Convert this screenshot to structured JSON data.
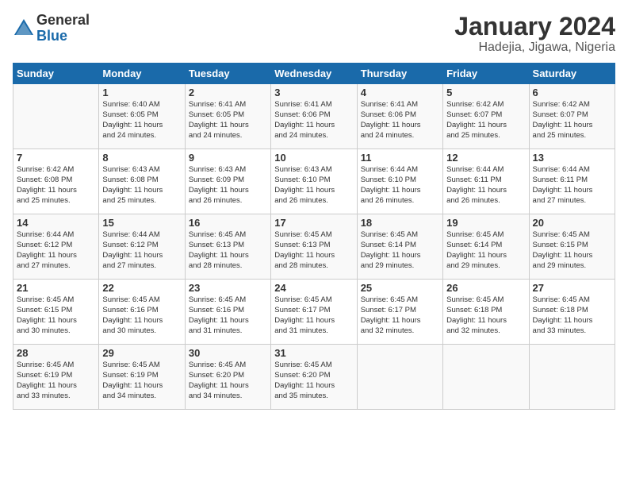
{
  "logo": {
    "general": "General",
    "blue": "Blue"
  },
  "title": "January 2024",
  "location": "Hadejia, Jigawa, Nigeria",
  "days_of_week": [
    "Sunday",
    "Monday",
    "Tuesday",
    "Wednesday",
    "Thursday",
    "Friday",
    "Saturday"
  ],
  "weeks": [
    [
      {
        "day": "",
        "info": ""
      },
      {
        "day": "1",
        "info": "Sunrise: 6:40 AM\nSunset: 6:05 PM\nDaylight: 11 hours\nand 24 minutes."
      },
      {
        "day": "2",
        "info": "Sunrise: 6:41 AM\nSunset: 6:05 PM\nDaylight: 11 hours\nand 24 minutes."
      },
      {
        "day": "3",
        "info": "Sunrise: 6:41 AM\nSunset: 6:06 PM\nDaylight: 11 hours\nand 24 minutes."
      },
      {
        "day": "4",
        "info": "Sunrise: 6:41 AM\nSunset: 6:06 PM\nDaylight: 11 hours\nand 24 minutes."
      },
      {
        "day": "5",
        "info": "Sunrise: 6:42 AM\nSunset: 6:07 PM\nDaylight: 11 hours\nand 25 minutes."
      },
      {
        "day": "6",
        "info": "Sunrise: 6:42 AM\nSunset: 6:07 PM\nDaylight: 11 hours\nand 25 minutes."
      }
    ],
    [
      {
        "day": "7",
        "info": "Sunrise: 6:42 AM\nSunset: 6:08 PM\nDaylight: 11 hours\nand 25 minutes."
      },
      {
        "day": "8",
        "info": "Sunrise: 6:43 AM\nSunset: 6:08 PM\nDaylight: 11 hours\nand 25 minutes."
      },
      {
        "day": "9",
        "info": "Sunrise: 6:43 AM\nSunset: 6:09 PM\nDaylight: 11 hours\nand 26 minutes."
      },
      {
        "day": "10",
        "info": "Sunrise: 6:43 AM\nSunset: 6:10 PM\nDaylight: 11 hours\nand 26 minutes."
      },
      {
        "day": "11",
        "info": "Sunrise: 6:44 AM\nSunset: 6:10 PM\nDaylight: 11 hours\nand 26 minutes."
      },
      {
        "day": "12",
        "info": "Sunrise: 6:44 AM\nSunset: 6:11 PM\nDaylight: 11 hours\nand 26 minutes."
      },
      {
        "day": "13",
        "info": "Sunrise: 6:44 AM\nSunset: 6:11 PM\nDaylight: 11 hours\nand 27 minutes."
      }
    ],
    [
      {
        "day": "14",
        "info": "Sunrise: 6:44 AM\nSunset: 6:12 PM\nDaylight: 11 hours\nand 27 minutes."
      },
      {
        "day": "15",
        "info": "Sunrise: 6:44 AM\nSunset: 6:12 PM\nDaylight: 11 hours\nand 27 minutes."
      },
      {
        "day": "16",
        "info": "Sunrise: 6:45 AM\nSunset: 6:13 PM\nDaylight: 11 hours\nand 28 minutes."
      },
      {
        "day": "17",
        "info": "Sunrise: 6:45 AM\nSunset: 6:13 PM\nDaylight: 11 hours\nand 28 minutes."
      },
      {
        "day": "18",
        "info": "Sunrise: 6:45 AM\nSunset: 6:14 PM\nDaylight: 11 hours\nand 29 minutes."
      },
      {
        "day": "19",
        "info": "Sunrise: 6:45 AM\nSunset: 6:14 PM\nDaylight: 11 hours\nand 29 minutes."
      },
      {
        "day": "20",
        "info": "Sunrise: 6:45 AM\nSunset: 6:15 PM\nDaylight: 11 hours\nand 29 minutes."
      }
    ],
    [
      {
        "day": "21",
        "info": "Sunrise: 6:45 AM\nSunset: 6:15 PM\nDaylight: 11 hours\nand 30 minutes."
      },
      {
        "day": "22",
        "info": "Sunrise: 6:45 AM\nSunset: 6:16 PM\nDaylight: 11 hours\nand 30 minutes."
      },
      {
        "day": "23",
        "info": "Sunrise: 6:45 AM\nSunset: 6:16 PM\nDaylight: 11 hours\nand 31 minutes."
      },
      {
        "day": "24",
        "info": "Sunrise: 6:45 AM\nSunset: 6:17 PM\nDaylight: 11 hours\nand 31 minutes."
      },
      {
        "day": "25",
        "info": "Sunrise: 6:45 AM\nSunset: 6:17 PM\nDaylight: 11 hours\nand 32 minutes."
      },
      {
        "day": "26",
        "info": "Sunrise: 6:45 AM\nSunset: 6:18 PM\nDaylight: 11 hours\nand 32 minutes."
      },
      {
        "day": "27",
        "info": "Sunrise: 6:45 AM\nSunset: 6:18 PM\nDaylight: 11 hours\nand 33 minutes."
      }
    ],
    [
      {
        "day": "28",
        "info": "Sunrise: 6:45 AM\nSunset: 6:19 PM\nDaylight: 11 hours\nand 33 minutes."
      },
      {
        "day": "29",
        "info": "Sunrise: 6:45 AM\nSunset: 6:19 PM\nDaylight: 11 hours\nand 34 minutes."
      },
      {
        "day": "30",
        "info": "Sunrise: 6:45 AM\nSunset: 6:20 PM\nDaylight: 11 hours\nand 34 minutes."
      },
      {
        "day": "31",
        "info": "Sunrise: 6:45 AM\nSunset: 6:20 PM\nDaylight: 11 hours\nand 35 minutes."
      },
      {
        "day": "",
        "info": ""
      },
      {
        "day": "",
        "info": ""
      },
      {
        "day": "",
        "info": ""
      }
    ]
  ]
}
